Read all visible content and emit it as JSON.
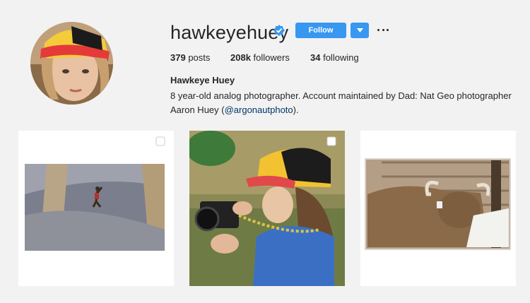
{
  "profile": {
    "username": "hawkeyehuey",
    "full_name": "Hawkeye Huey",
    "bio_text": "8 year-old analog photographer. Account maintained by Dad: Nat Geo photographer Aaron Huey (",
    "bio_link": "@argonautphoto",
    "bio_end": ")."
  },
  "actions": {
    "follow_label": "Follow"
  },
  "stats": {
    "posts_count": "379",
    "posts_label": "posts",
    "followers_count": "208k",
    "followers_label": "followers",
    "following_count": "34",
    "following_label": "following"
  },
  "posts": [
    {
      "subject": "rock climber on cliff face",
      "multi": true
    },
    {
      "subject": "child holding camera",
      "multi": true
    },
    {
      "subject": "bull in wooden pen",
      "multi": false
    }
  ],
  "colors": {
    "accent": "#3897f0",
    "link": "#003569",
    "text": "#262626"
  }
}
